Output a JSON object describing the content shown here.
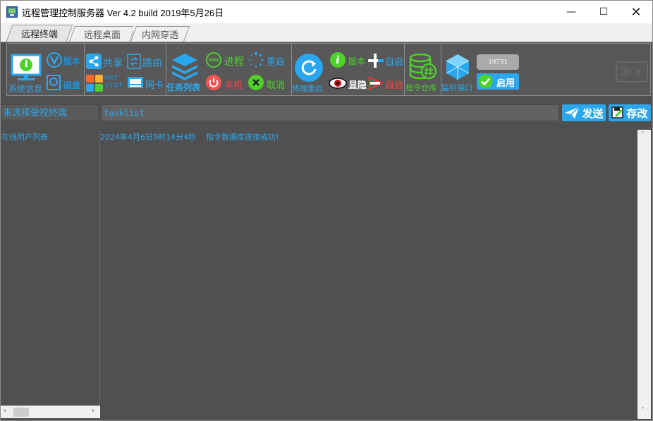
{
  "window": {
    "title": "远程管理控制服务器 Ver 4.2 build 2019年5月26日",
    "minimize": "—",
    "maximize": "☐",
    "close": "✕"
  },
  "tabs": [
    {
      "label": "远程终端",
      "active": true
    },
    {
      "label": "远程桌面",
      "active": false
    },
    {
      "label": "内网穿透",
      "active": false
    }
  ],
  "toolbar": {
    "sysinfo": "系统信息",
    "version": "版本",
    "disk": "磁盘",
    "share": "共享",
    "route": "路由",
    "netstat": "net\nstat",
    "nic": "网卡",
    "tasklist": "任务列表",
    "end_badge": "END",
    "process": "进程",
    "restart": "重启",
    "shutdown": "关机",
    "cancel": "取消",
    "terminal_restart": "终端重启",
    "version2": "版本",
    "autostart_add": "自启",
    "show_hide": "显隐",
    "autostart_remove": "自启",
    "cmd_repo": "指令仓库",
    "listen_port": "监听端口",
    "port_value": "19731",
    "enable": "启用"
  },
  "client": {
    "label": "未选择受控终端"
  },
  "command": {
    "value": "tasklist"
  },
  "buttons": {
    "send": "发送",
    "save": "存改"
  },
  "userlist": {
    "title": "在线用户列表"
  },
  "log": {
    "line": "2024年4月6日9时14分4秒    指令数据库连接成功!"
  },
  "colors": {
    "accent": "#2aa7ee",
    "panel": "#505050",
    "green": "#4ed12b",
    "red": "#ff4040"
  }
}
